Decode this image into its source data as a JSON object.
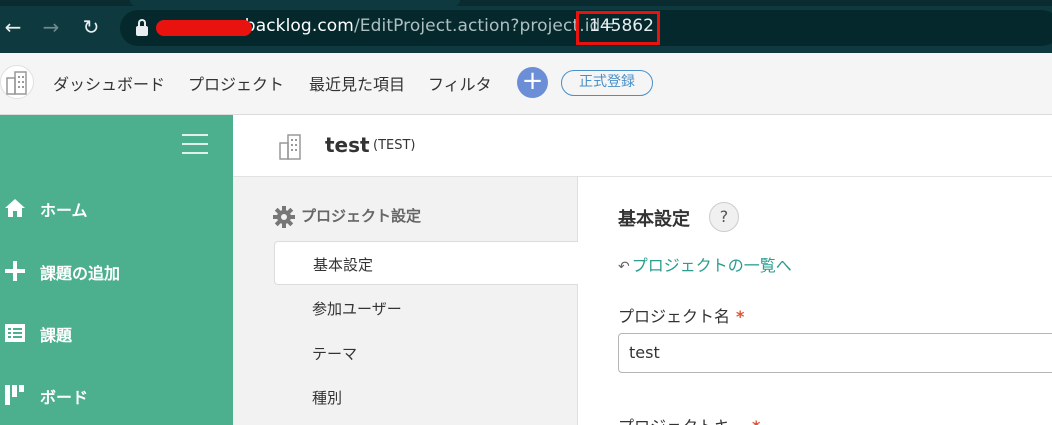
{
  "browser": {
    "url_prefix": ".backlog.com/EditProject.action?project.id=",
    "url_host": ".backlog.com",
    "url_path": "/EditProject.action?project.id",
    "url_equals": "=",
    "project_id": "145862",
    "highlight_color": "#e8130e"
  },
  "header": {
    "nav": [
      "ダッシュボード",
      "プロジェクト",
      "最近見た項目",
      "フィルタ"
    ],
    "plus_symbol": "+",
    "register_label": "正式登録"
  },
  "sidebar": {
    "items": [
      {
        "label": "ホーム",
        "icon": "home-icon"
      },
      {
        "label": "課題の追加",
        "icon": "plus-icon"
      },
      {
        "label": "課題",
        "icon": "list-icon"
      },
      {
        "label": "ボード",
        "icon": "board-icon"
      }
    ],
    "color": "#4caf8d"
  },
  "project": {
    "name": "test",
    "key": "(TEST)"
  },
  "settings_nav": {
    "heading": "プロジェクト設定",
    "items": [
      "基本設定",
      "参加ユーザー",
      "テーマ",
      "種別"
    ],
    "active_index": 0
  },
  "main": {
    "title": "基本設定",
    "help": "?",
    "back_link": "プロジェクトの一覧へ",
    "back_arrow": "↶",
    "fields": [
      {
        "label": "プロジェクト名",
        "required": "*",
        "value": "test"
      },
      {
        "label": "プロジェクトキー",
        "required": "*"
      }
    ],
    "accent_color": "#2a9d8f"
  }
}
